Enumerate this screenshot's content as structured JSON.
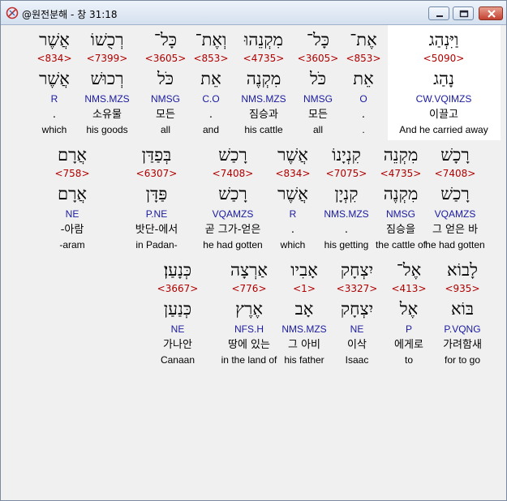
{
  "window": {
    "title": "@원전분해 - 창 31:18",
    "colors": {
      "strong": "#b00000",
      "morph": "#1a1aa0",
      "highlight": "#ffffff"
    }
  },
  "lines": [
    {
      "words": [
        {
          "heb": "וַיִּנְהַג",
          "strong": "<5090>",
          "lemma": "נָהַג",
          "morph": "CW.VQIMZS",
          "kor": "이끌고",
          "eng": "And he carried away"
        },
        {
          "heb": "אֶת־",
          "strong": "<853>",
          "lemma": "אֵת",
          "morph": "O",
          "kor": ".",
          "eng": "."
        },
        {
          "heb": "כָּל־",
          "strong": "<3605>",
          "lemma": "כֹּל",
          "morph": "NMSG",
          "kor": "모든",
          "eng": "all"
        },
        {
          "heb": "מִקְנֵהוּ",
          "strong": "<4735>",
          "lemma": "מִקְנֶה",
          "morph": "NMS.MZS",
          "kor": "짐승과",
          "eng": "his cattle"
        },
        {
          "heb": "וְאֶת־",
          "strong": "<853>",
          "lemma": "אֵת",
          "morph": "C.O",
          "kor": ".",
          "eng": "and"
        },
        {
          "heb": "כָּל־",
          "strong": "<3605>",
          "lemma": "כֹּל",
          "morph": "NMSG",
          "kor": "모든",
          "eng": "all"
        },
        {
          "heb": "רְכֻשׁוֹ",
          "strong": "<7399>",
          "lemma": "רְכוּשׁ",
          "morph": "NMS.MZS",
          "kor": "소유물",
          "eng": "his goods"
        },
        {
          "heb": "אֲשֶׁר",
          "strong": "<834>",
          "lemma": "אֲשֶׁר",
          "morph": "R",
          "kor": ".",
          "eng": "which"
        }
      ]
    },
    {
      "words": [
        {
          "heb": "רָכָשׁ",
          "strong": "<7408>",
          "lemma": "רָכַשׁ",
          "morph": "VQAMZS",
          "kor": "그 얻은 바",
          "eng": "he had gotten"
        },
        {
          "heb": "מִקְנֵה",
          "strong": "<4735>",
          "lemma": "מִקְנֶה",
          "morph": "NMSG",
          "kor": "짐승을",
          "eng": "the cattle of"
        },
        {
          "heb": "קִנְיָנוֹ",
          "strong": "<7075>",
          "lemma": "קִנְיָן",
          "morph": "NMS.MZS",
          "kor": ".",
          "eng": "his getting"
        },
        {
          "heb": "אֲשֶׁר",
          "strong": "<834>",
          "lemma": "אֲשֶׁר",
          "morph": "R",
          "kor": ".",
          "eng": "which"
        },
        {
          "heb": "רָכַשׁ",
          "strong": "<7408>",
          "lemma": "רָכַשׁ",
          "morph": "VQAMZS",
          "kor": "곧 그가-얻은",
          "eng": "he had gotten"
        },
        {
          "heb": "בְּפַדַּן",
          "strong": "<6307>",
          "lemma": "פַּדָּן",
          "morph": "P.NE",
          "kor": "밧단-에서",
          "eng": "in Padan-"
        },
        {
          "heb": "אֲרָם",
          "strong": "<758>",
          "lemma": "אֲרָם",
          "morph": "NE",
          "kor": "-아람",
          "eng": "-aram"
        }
      ]
    },
    {
      "words": [
        {
          "heb": "לָבוֹא",
          "strong": "<935>",
          "lemma": "בּוֹא",
          "morph": "P.VQNG",
          "kor": "가려함새",
          "eng": "for to go"
        },
        {
          "heb": "אֶל־",
          "strong": "<413>",
          "lemma": "אֶל",
          "morph": "P",
          "kor": "에게로",
          "eng": "to"
        },
        {
          "heb": "יִצְחָק",
          "strong": "<3327>",
          "lemma": "יִצְחָק",
          "morph": "NE",
          "kor": "이삭",
          "eng": "Isaac"
        },
        {
          "heb": "אָבִיו",
          "strong": "<1>",
          "lemma": "אָב",
          "morph": "NMS.MZS",
          "kor": "그 아비",
          "eng": "his father"
        },
        {
          "heb": "אַרְצָה",
          "strong": "<776>",
          "lemma": "אֶרֶץ",
          "morph": "NFS.H",
          "kor": "땅에 있는",
          "eng": "in the land of"
        },
        {
          "heb": "כְּנָעַן׃",
          "strong": "<3667>",
          "lemma": "כְּנַעַן",
          "morph": "NE",
          "kor": "가나안",
          "eng": "Canaan"
        }
      ]
    }
  ]
}
